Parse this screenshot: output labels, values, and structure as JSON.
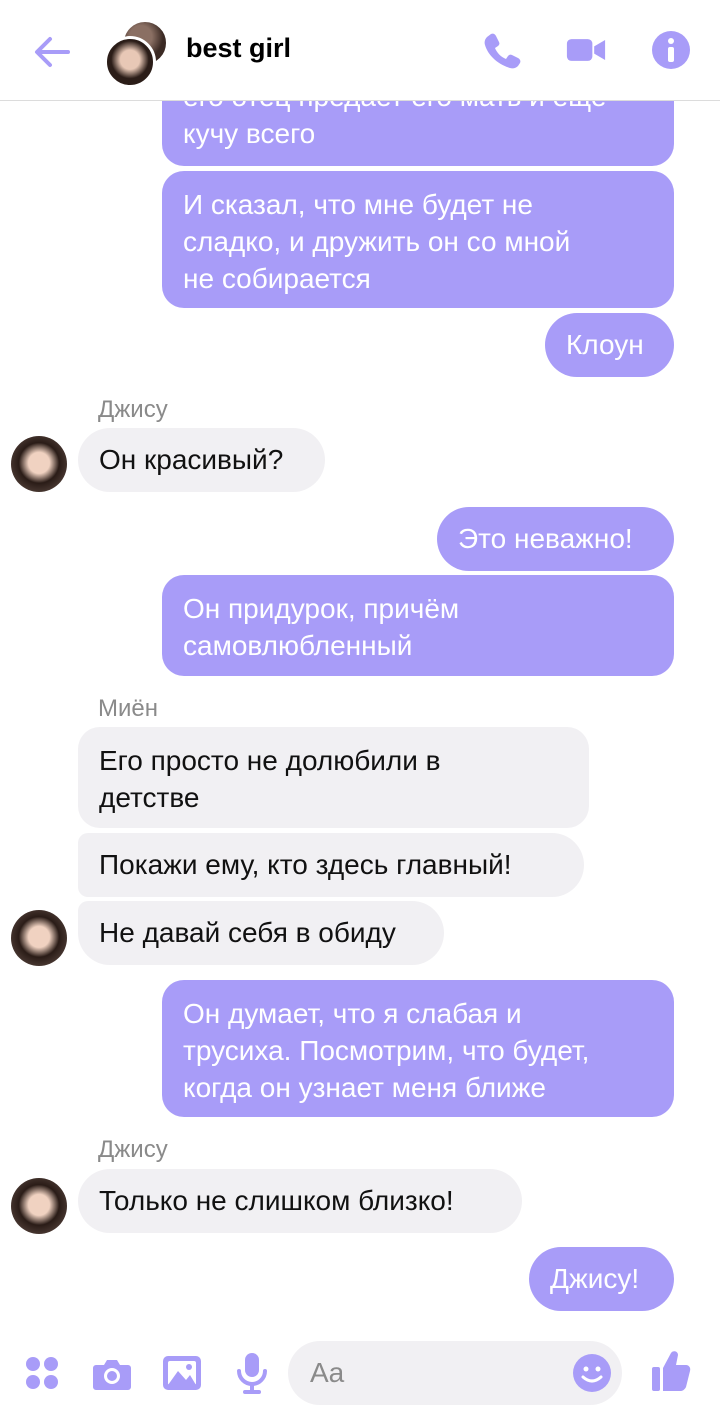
{
  "header": {
    "title": "best girl"
  },
  "colors": {
    "accent": "#a89cf8",
    "incoming": "#f1f0f3"
  },
  "messages": [
    {
      "dir": "out",
      "text": "его отец предает его мать и еще\nкучу всего"
    },
    {
      "dir": "out",
      "text": "И сказал, что мне будет не\nсладко, и дружить он со мной\nне собирается"
    },
    {
      "dir": "out",
      "text": "Клоун"
    },
    {
      "sender": "Джису"
    },
    {
      "dir": "in",
      "text": "Он красивый?"
    },
    {
      "dir": "out",
      "text": "Это неважно!"
    },
    {
      "dir": "out",
      "text": "Он придурок, причём\nсамовлюбленный"
    },
    {
      "sender": "Миён"
    },
    {
      "dir": "in",
      "text": "Его просто не долюбили в\nдетстве"
    },
    {
      "dir": "in",
      "text": "Покажи ему, кто здесь главный!"
    },
    {
      "dir": "in",
      "text": "Не давай себя в обиду"
    },
    {
      "dir": "out",
      "text": "Он думает, что я слабая и\nтрусиха. Посмотрим, что будет,\nкогда он узнает меня ближе"
    },
    {
      "sender": "Джису"
    },
    {
      "dir": "in",
      "text": "Только не слишком близко!"
    },
    {
      "dir": "out",
      "text": "Джису!"
    }
  ],
  "composer": {
    "placeholder": "Aa"
  },
  "icons": [
    "back-arrow-icon",
    "phone-icon",
    "video-icon",
    "info-icon",
    "apps-icon",
    "camera-icon",
    "image-icon",
    "mic-icon",
    "emoji-icon",
    "thumbs-up-icon"
  ]
}
